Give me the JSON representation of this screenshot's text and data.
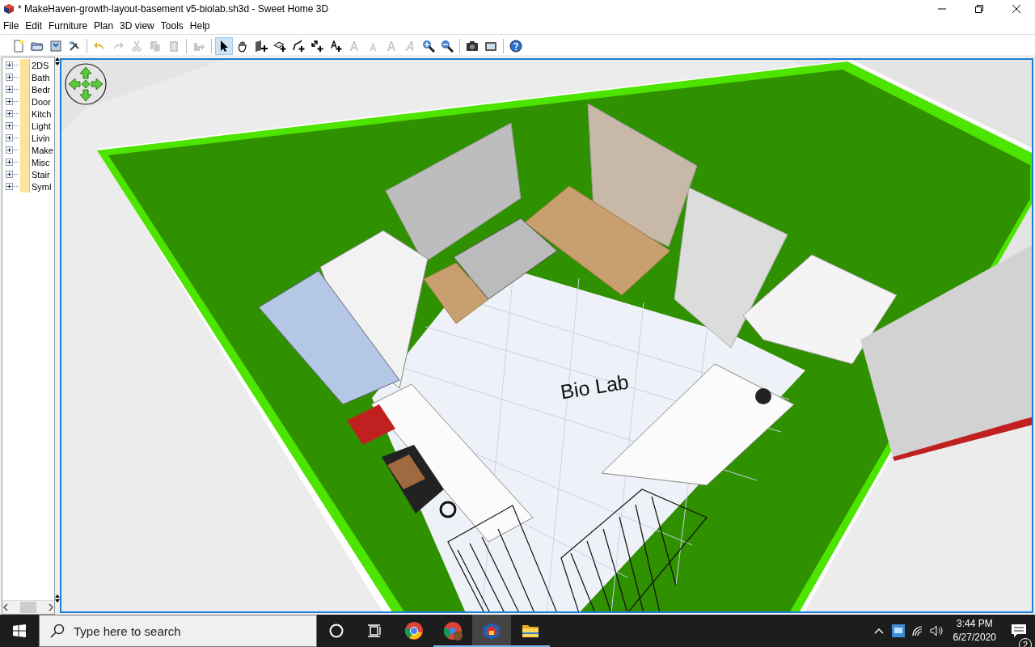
{
  "window": {
    "title": "* MakeHaven-growth-layout-basement v5-biolab.sh3d - Sweet Home 3D"
  },
  "menu": [
    "File",
    "Edit",
    "Furniture",
    "Plan",
    "3D view",
    "Tools",
    "Help"
  ],
  "toolbar": {
    "groups": [
      [
        {
          "selected": false,
          "disabled": false
        },
        {
          "selected": false,
          "disabled": false
        },
        {
          "selected": false,
          "disabled": false
        },
        {
          "selected": false,
          "disabled": false
        }
      ],
      [
        {
          "selected": false,
          "disabled": false
        },
        {
          "selected": false,
          "disabled": true
        },
        {
          "selected": false,
          "disabled": true
        },
        {
          "selected": false,
          "disabled": true
        },
        {
          "selected": false,
          "disabled": true
        }
      ],
      [
        {
          "selected": false,
          "disabled": true
        }
      ],
      [
        {
          "selected": true,
          "disabled": false
        },
        {
          "selected": false,
          "disabled": false
        },
        {
          "selected": false,
          "disabled": false
        },
        {
          "selected": false,
          "disabled": false
        },
        {
          "selected": false,
          "disabled": false
        },
        {
          "selected": false,
          "disabled": false
        },
        {
          "selected": false,
          "disabled": false
        },
        {
          "selected": false,
          "disabled": true
        },
        {
          "selected": false,
          "disabled": true
        },
        {
          "selected": false,
          "disabled": true
        },
        {
          "selected": false,
          "disabled": true
        },
        {
          "selected": false,
          "disabled": false
        },
        {
          "selected": false,
          "disabled": false
        }
      ],
      [
        {
          "selected": false,
          "disabled": false
        },
        {
          "selected": false,
          "disabled": false
        }
      ],
      [
        {
          "selected": false,
          "disabled": false
        }
      ]
    ]
  },
  "catalog": {
    "items": [
      {
        "label": "2DS",
        "expanded": false
      },
      {
        "label": "Bath",
        "expanded": false
      },
      {
        "label": "Bedr",
        "expanded": false
      },
      {
        "label": "Door",
        "expanded": false
      },
      {
        "label": "Kitch",
        "expanded": false
      },
      {
        "label": "Light",
        "expanded": false
      },
      {
        "label": "Livin",
        "expanded": false
      },
      {
        "label": "Make",
        "expanded": false
      },
      {
        "label": "Misc",
        "expanded": false
      },
      {
        "label": "Stair",
        "expanded": false
      },
      {
        "label": "Syml",
        "expanded": false
      }
    ]
  },
  "view_3d": {
    "room_label": "Bio Lab"
  },
  "taskbar": {
    "search": {
      "placeholder": "Type here to search"
    },
    "apps": [
      {
        "running": false,
        "selected": false
      },
      {
        "running": true,
        "selected": false
      },
      {
        "running": true,
        "selected": true
      },
      {
        "running": true,
        "selected": false
      }
    ],
    "clock": {
      "time": "3:44 PM",
      "date": "6/27/2020"
    },
    "notifications": {
      "count": "2"
    }
  }
}
